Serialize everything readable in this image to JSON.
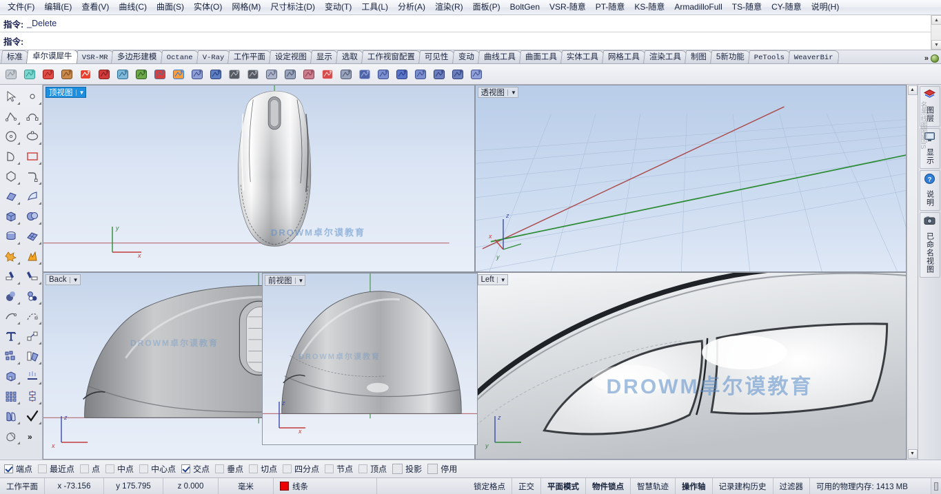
{
  "menu": {
    "items": [
      "文件(F)",
      "编辑(E)",
      "查看(V)",
      "曲线(C)",
      "曲面(S)",
      "实体(O)",
      "网格(M)",
      "尺寸标注(D)",
      "变动(T)",
      "工具(L)",
      "分析(A)",
      "渲染(R)",
      "面板(P)",
      "BoltGen",
      "VSR-随意",
      "PT-随意",
      "KS-随意",
      "ArmadilloFull",
      "TS-随意",
      "CY-随意",
      "说明(H)"
    ]
  },
  "command": {
    "history_prompt": "指令:",
    "history_text": "_Delete",
    "input_prompt": "指令:",
    "input_value": "",
    "input_placeholder": ""
  },
  "toolbar_tabs": {
    "active_index": 1,
    "items": [
      {
        "label": "标准",
        "mono": false
      },
      {
        "label": "卓尔谟犀牛",
        "mono": false
      },
      {
        "label": "VSR-MR",
        "mono": true
      },
      {
        "label": "多边形建模",
        "mono": false
      },
      {
        "label": "Octane",
        "mono": true
      },
      {
        "label": "V-Ray",
        "mono": true
      },
      {
        "label": "工作平面",
        "mono": false
      },
      {
        "label": "设定视图",
        "mono": false
      },
      {
        "label": "显示",
        "mono": false
      },
      {
        "label": "选取",
        "mono": false
      },
      {
        "label": "工作视窗配置",
        "mono": false
      },
      {
        "label": "可见性",
        "mono": false
      },
      {
        "label": "变动",
        "mono": false
      },
      {
        "label": "曲线工具",
        "mono": false
      },
      {
        "label": "曲面工具",
        "mono": false
      },
      {
        "label": "实体工具",
        "mono": false
      },
      {
        "label": "网格工具",
        "mono": false
      },
      {
        "label": "渲染工具",
        "mono": false
      },
      {
        "label": "制图",
        "mono": false
      },
      {
        "label": "5新功能",
        "mono": false
      },
      {
        "label": "PeTools",
        "mono": true
      },
      {
        "label": "WeaverBir",
        "mono": true
      }
    ],
    "overflow_label": "»"
  },
  "icon_toolbar": {
    "icons": [
      "curve-blend-icon",
      "mesh-box-icon",
      "extrude-red-icon",
      "sphere-texture-icon",
      "checker-map-icon",
      "link-chain-icon",
      "blue-disc-icon",
      "picture-frame-icon",
      "gumball-query-icon",
      "rainbow-plane-icon",
      "surface-curve-icon",
      "rotate-sphere-icon",
      "checker-grid-icon",
      "checker-grid2-icon",
      "flat-surface-icon",
      "rectangle-point-icon",
      "target-circle-icon",
      "tilted-disc-icon",
      "sphere-point-icon",
      "control-points-icon",
      "cylinder-icon",
      "diamond-icon",
      "scatter-points-icon",
      "grid-array-icon",
      "block-shade-icon",
      "cube-panel-icon"
    ]
  },
  "left_toolbar": {
    "icons": [
      "arrow-select-icon",
      "point-icon",
      "polyline-icon",
      "curve-cv-icon",
      "circle-icon",
      "ellipse-cv-icon",
      "arc-triangle-icon",
      "rectangle-icon",
      "polygon-icon",
      "fillet-curve-icon",
      "surface-cv-icon",
      "loft-surface-icon",
      "box-solid-icon",
      "sphere-solid-icon",
      "cylinder-cut-icon",
      "surface-grid-icon",
      "boolean-star-icon",
      "explode-icon",
      "trim-icon",
      "split-icon",
      "boolean-union-icon",
      "boolean-diff-icon",
      "offset-curve-icon",
      "blend-curve-icon",
      "text-icon",
      "scale-icon",
      "array-icon",
      "mirror-icon",
      "cap-solid-icon",
      "extract-surface-icon",
      "array-grid-icon",
      "vertical-array-icon",
      "unroll-icon",
      "check-icon",
      "shade-icon",
      "more-icon"
    ],
    "more_label": "»"
  },
  "viewports": [
    {
      "name": "top",
      "label": "顶视图",
      "active": true,
      "caret": "▼",
      "watermark": "DROWM卓尔谟教育",
      "axis": {
        "x": "x",
        "y": "y"
      }
    },
    {
      "name": "perspective",
      "label": "透视图",
      "active": false,
      "caret": "▼",
      "watermark": "",
      "axis": {
        "x": "x",
        "y": "y",
        "z": "z"
      }
    },
    {
      "name": "back",
      "label": "Back",
      "active": false,
      "caret": "▼",
      "watermark": "DROWM卓尔谟教育",
      "axis": {
        "x": "x",
        "z": "z"
      }
    },
    {
      "name": "front",
      "label": "前视图",
      "active": false,
      "caret": "▼",
      "watermark": "DROWM卓尔谟教育",
      "axis": {
        "x": "x",
        "z": "z"
      }
    },
    {
      "name": "left",
      "label": "Left",
      "active": false,
      "caret": "▼",
      "watermark": "DROWM卓尔谟教育",
      "axis": {
        "y": "y",
        "z": "z"
      }
    }
  ],
  "right_panel": {
    "tabs": [
      {
        "label": "图层",
        "icon": "layers-icon"
      },
      {
        "label": "显示",
        "icon": "display-monitor-icon"
      },
      {
        "label": "说明",
        "icon": "notes-help-icon"
      },
      {
        "label": "已命名视图",
        "icon": "named-views-camera-icon"
      }
    ],
    "ghost_labels": "名黑线图图图IS"
  },
  "osnap": {
    "items": [
      {
        "label": "端点",
        "checked": true,
        "style": "normal"
      },
      {
        "label": "最近点",
        "checked": false,
        "style": "dim"
      },
      {
        "label": "点",
        "checked": false,
        "style": "dim"
      },
      {
        "label": "中点",
        "checked": false,
        "style": "dim"
      },
      {
        "label": "中心点",
        "checked": false,
        "style": "dim"
      },
      {
        "label": "交点",
        "checked": true,
        "style": "normal"
      },
      {
        "label": "垂点",
        "checked": false,
        "style": "dim"
      },
      {
        "label": "切点",
        "checked": false,
        "style": "dim"
      },
      {
        "label": "四分点",
        "checked": false,
        "style": "dim"
      },
      {
        "label": "节点",
        "checked": false,
        "style": "dim"
      },
      {
        "label": "顶点",
        "checked": false,
        "style": "dim"
      },
      {
        "label": "投影",
        "checked": false,
        "style": "big"
      },
      {
        "label": "停用",
        "checked": false,
        "style": "big"
      }
    ]
  },
  "statusbar": {
    "cplane": "工作平面",
    "x": "x -73.156",
    "y": "y 175.795",
    "z": "z 0.000",
    "units": "毫米",
    "layer": "线条",
    "layer_color": "#ee0000",
    "toggles": [
      {
        "label": "锁定格点",
        "active": false
      },
      {
        "label": "正交",
        "active": false
      },
      {
        "label": "平面模式",
        "active": true
      },
      {
        "label": "物件锁点",
        "active": true
      },
      {
        "label": "智慧轨迹",
        "active": false
      },
      {
        "label": "操作轴",
        "active": true
      },
      {
        "label": "记录建构历史",
        "active": false
      },
      {
        "label": "过滤器",
        "active": false
      }
    ],
    "memory": "可用的物理内存: 1413 MB"
  }
}
